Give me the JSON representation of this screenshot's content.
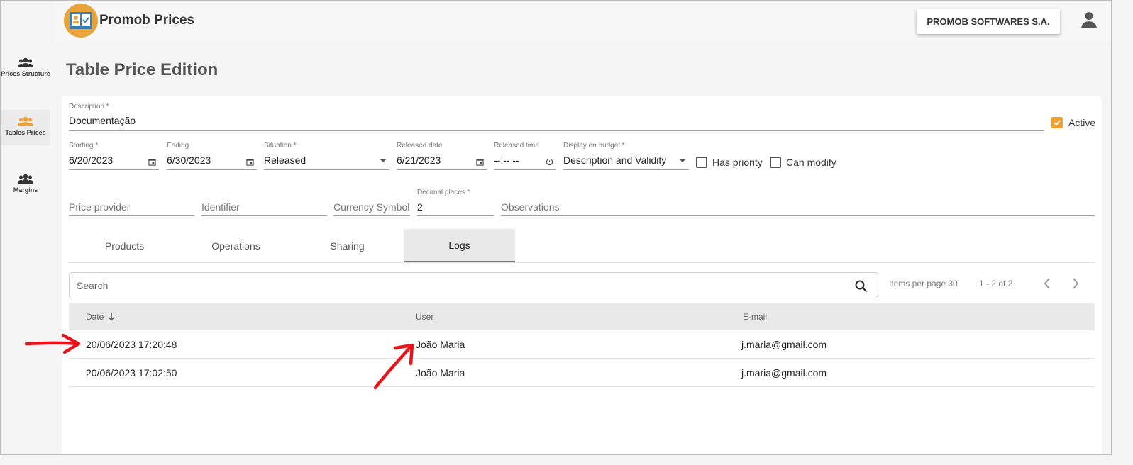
{
  "header": {
    "app_title": "Promob Prices",
    "company": "PROMOB SOFTWARES S.A.",
    "logo_icon": "board-icon",
    "user_icon": "person-icon",
    "accent": "#e8a43a"
  },
  "sidebar": {
    "items": [
      {
        "label": "Prices Structure",
        "icon": "group-icon",
        "active": false
      },
      {
        "label": "Tables Prices",
        "icon": "group-icon",
        "active": true
      },
      {
        "label": "Margins",
        "icon": "group-icon",
        "active": false
      }
    ]
  },
  "page": {
    "title": "Table Price Edition"
  },
  "form": {
    "description": {
      "label": "Description *",
      "value": "Documentação"
    },
    "active": {
      "label": "Active",
      "checked": true
    },
    "starting": {
      "label": "Starting *",
      "value": "6/20/2023"
    },
    "ending": {
      "label": "Ending",
      "value": "6/30/2023"
    },
    "situation": {
      "label": "Situation *",
      "value": "Released"
    },
    "released_date": {
      "label": "Released date",
      "value": "6/21/2023"
    },
    "released_time": {
      "label": "Released time",
      "value": "--:-- --"
    },
    "display_on_budget": {
      "label": "Display on budget *",
      "value": "Description and Validity"
    },
    "has_priority": {
      "label": "Has priority",
      "checked": false
    },
    "can_modify": {
      "label": "Can modify",
      "checked": false
    },
    "price_provider": {
      "placeholder": "Price provider"
    },
    "identifier": {
      "placeholder": "Identifier"
    },
    "currency_symbol": {
      "placeholder": "Currency Symbol"
    },
    "decimal_places": {
      "label": "Decimal places *",
      "value": "2"
    },
    "observations": {
      "placeholder": "Observations"
    }
  },
  "tabs": [
    {
      "label": "Products",
      "active": false
    },
    {
      "label": "Operations",
      "active": false
    },
    {
      "label": "Sharing",
      "active": false
    },
    {
      "label": "Logs",
      "active": true
    }
  ],
  "logs": {
    "search_placeholder": "Search",
    "items_per_page": "Items per page 30",
    "range": "1 - 2 of 2",
    "prev_icon": "chevron-left-icon",
    "next_icon": "chevron-right-icon",
    "columns": [
      "Date",
      "User",
      "E-mail"
    ],
    "rows": [
      {
        "date": "20/06/2023 17:20:48",
        "user": "João Maria",
        "email": "j.maria@gmail.com"
      },
      {
        "date": "20/06/2023 17:02:50",
        "user": "João Maria",
        "email": "j.maria@gmail.com"
      }
    ]
  },
  "annotation_color": "#e8141c"
}
